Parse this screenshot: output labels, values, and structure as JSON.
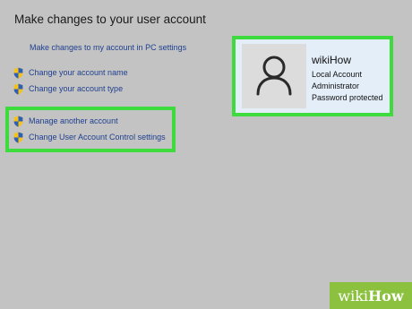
{
  "page": {
    "title": "Make changes to your user account",
    "pc_settings_link": "Make changes to my account in PC settings"
  },
  "tasks": [
    {
      "label": "Change your account name",
      "icon": "uac-shield-icon"
    },
    {
      "label": "Change your account type",
      "icon": "uac-shield-icon"
    },
    {
      "label": "Manage another account",
      "icon": "uac-shield-icon"
    },
    {
      "label": "Change User Account Control settings",
      "icon": "uac-shield-icon"
    }
  ],
  "account": {
    "name": "wikiHow",
    "details": [
      "Local Account",
      "Administrator",
      "Password protected"
    ],
    "avatar_icon": "user-silhouette-icon"
  },
  "highlight_color": "#3edb3e",
  "watermark": {
    "lead": "wiki",
    "tail": "How"
  }
}
